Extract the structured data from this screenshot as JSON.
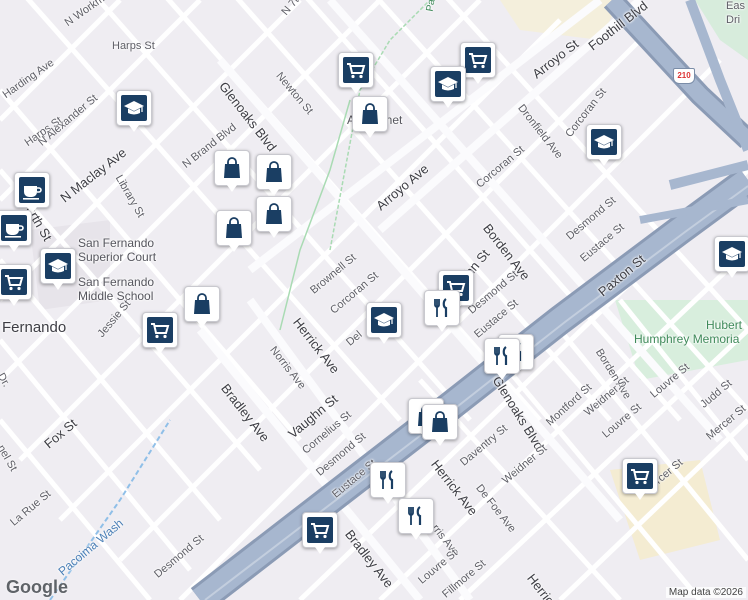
{
  "map": {
    "attribution": "Map data ©2026",
    "logo": "Google",
    "highway_shield": "210"
  },
  "labels": {
    "l_workman": "N Workm",
    "l_harps1": "Harps St",
    "l_harding": "Harding Ave",
    "l_harps2": "Harps St",
    "l_alexander": "N Alexander St",
    "l_fourth": "Fourth St",
    "l_maclay": "N Maclay Ave",
    "l_library": "Library St",
    "l_nbrand": "N Brand Blvd",
    "l_glenoaks1": "Glenoaks Blvd",
    "l_newton": "Newton St",
    "l_7th": "N 7th St",
    "l_magnet": "Ar    Magnet",
    "l_arroyo_st": "Arroyo St",
    "l_foothill": "Foothill Blvd",
    "l_dronfield": "Dronfield Ave",
    "l_corcoran1": "Corcoran St",
    "l_corcoran2": "Corcoran St",
    "l_arroyo_ave": "Arroyo Ave",
    "l_borden1": "Borden Ave",
    "l_desmond1": "Desmond St",
    "l_eustace1": "Eustace St",
    "l_paxton": "Paxton St",
    "l_hubert": "Hubert",
    "l_humphrey": "Humphrey Memoria",
    "l_sf_court1": "San Fernando",
    "l_sf_court2": "Superior Court",
    "l_sf_ms1": "San Fernando",
    "l_sf_ms2": "Middle School",
    "l_fernando": "Fernando",
    "l_jessie": "Jessie St",
    "l_brownell": "Brownell St",
    "l_corcoran3": "Corcoran St",
    "l_del": "Del",
    "l_herrick1": "Herrick Ave",
    "l_vaughn1": "ughn St",
    "l_desmond2": "Desmond St",
    "l_eustace2": "Eustace St",
    "l_norris1": "Norris Ave",
    "l_bradley1": "Bradley Ave",
    "l_vaughn2": "Vaughn St",
    "l_cornelius": "Cornelius St",
    "l_desmond3": "Desmond St",
    "l_eustace3": "Eustace St",
    "l_glenoaks2": "Glenoaks Blvd",
    "l_borden2": "Borden Ave",
    "l_montford": "Montford St",
    "l_weidner1": "Weidner St",
    "l_louvre1": "Louvre St",
    "l_louvre2": "Louvre St",
    "l_judd": "Judd St",
    "l_mercer1": "Mercer St",
    "l_mercer2": "ercer St",
    "l_daventry": "Daventry St",
    "l_weidner2": "Weidner St",
    "l_defoe": "De Foe Ave",
    "l_herrick2": "Herrick Ave",
    "l_herrick3": "Herrick",
    "l_norris2": "rris Ave",
    "l_bradley2": "Bradley Ave",
    "l_louvre3": "Louvre St",
    "l_fillmore": "Fillmore St",
    "l_fox": "Fox St",
    "l_larue": "La Rue St",
    "l_desmond4": "Desmond St",
    "l_pacoima": "Pacoima Wash",
    "l_nel": "nel St",
    "l_pacoima_top": "Pacoima",
    "l_eas": "Eas",
    "l_dri": "Dri",
    "l_dr": "Dr."
  },
  "pins": [
    {
      "kind": "shopping-cart",
      "label": "grocery"
    },
    {
      "kind": "shopping-cart",
      "label": "grocery"
    },
    {
      "kind": "graduation-cap",
      "label": "school"
    },
    {
      "kind": "shopping-bag",
      "label": "store"
    },
    {
      "kind": "graduation-cap",
      "label": "school"
    },
    {
      "kind": "shopping-bag",
      "label": "store"
    },
    {
      "kind": "shopping-bag",
      "label": "store"
    },
    {
      "kind": "shopping-bag",
      "label": "store"
    },
    {
      "kind": "shopping-bag",
      "label": "store"
    },
    {
      "kind": "coffee-cup",
      "label": "cafe"
    },
    {
      "kind": "coffee-cup",
      "label": "cafe"
    },
    {
      "kind": "graduation-cap",
      "label": "school"
    },
    {
      "kind": "shopping-cart",
      "label": "grocery"
    },
    {
      "kind": "shopping-bag",
      "label": "store"
    },
    {
      "kind": "shopping-cart",
      "label": "grocery"
    },
    {
      "kind": "graduation-cap",
      "label": "school"
    },
    {
      "kind": "shopping-cart",
      "label": "grocery"
    },
    {
      "kind": "fork-knife",
      "label": "restaurant"
    },
    {
      "kind": "fork-knife",
      "label": "restaurant"
    },
    {
      "kind": "graduation-cap",
      "label": "school"
    },
    {
      "kind": "graduation-cap",
      "label": "school"
    },
    {
      "kind": "shopping-bag",
      "label": "store"
    },
    {
      "kind": "shopping-bag",
      "label": "store"
    },
    {
      "kind": "fork-knife",
      "label": "restaurant"
    },
    {
      "kind": "fork-knife",
      "label": "restaurant"
    },
    {
      "kind": "fork-knife",
      "label": "restaurant"
    },
    {
      "kind": "shopping-cart",
      "label": "grocery"
    },
    {
      "kind": "shopping-cart",
      "label": "grocery"
    }
  ],
  "colors": {
    "pin_fill": "#1a3e63",
    "highway": "#9fb0c9",
    "highway_edge": "#8b9bb5",
    "park": "#cfe8d4",
    "school_area": "#f3ecd6"
  }
}
